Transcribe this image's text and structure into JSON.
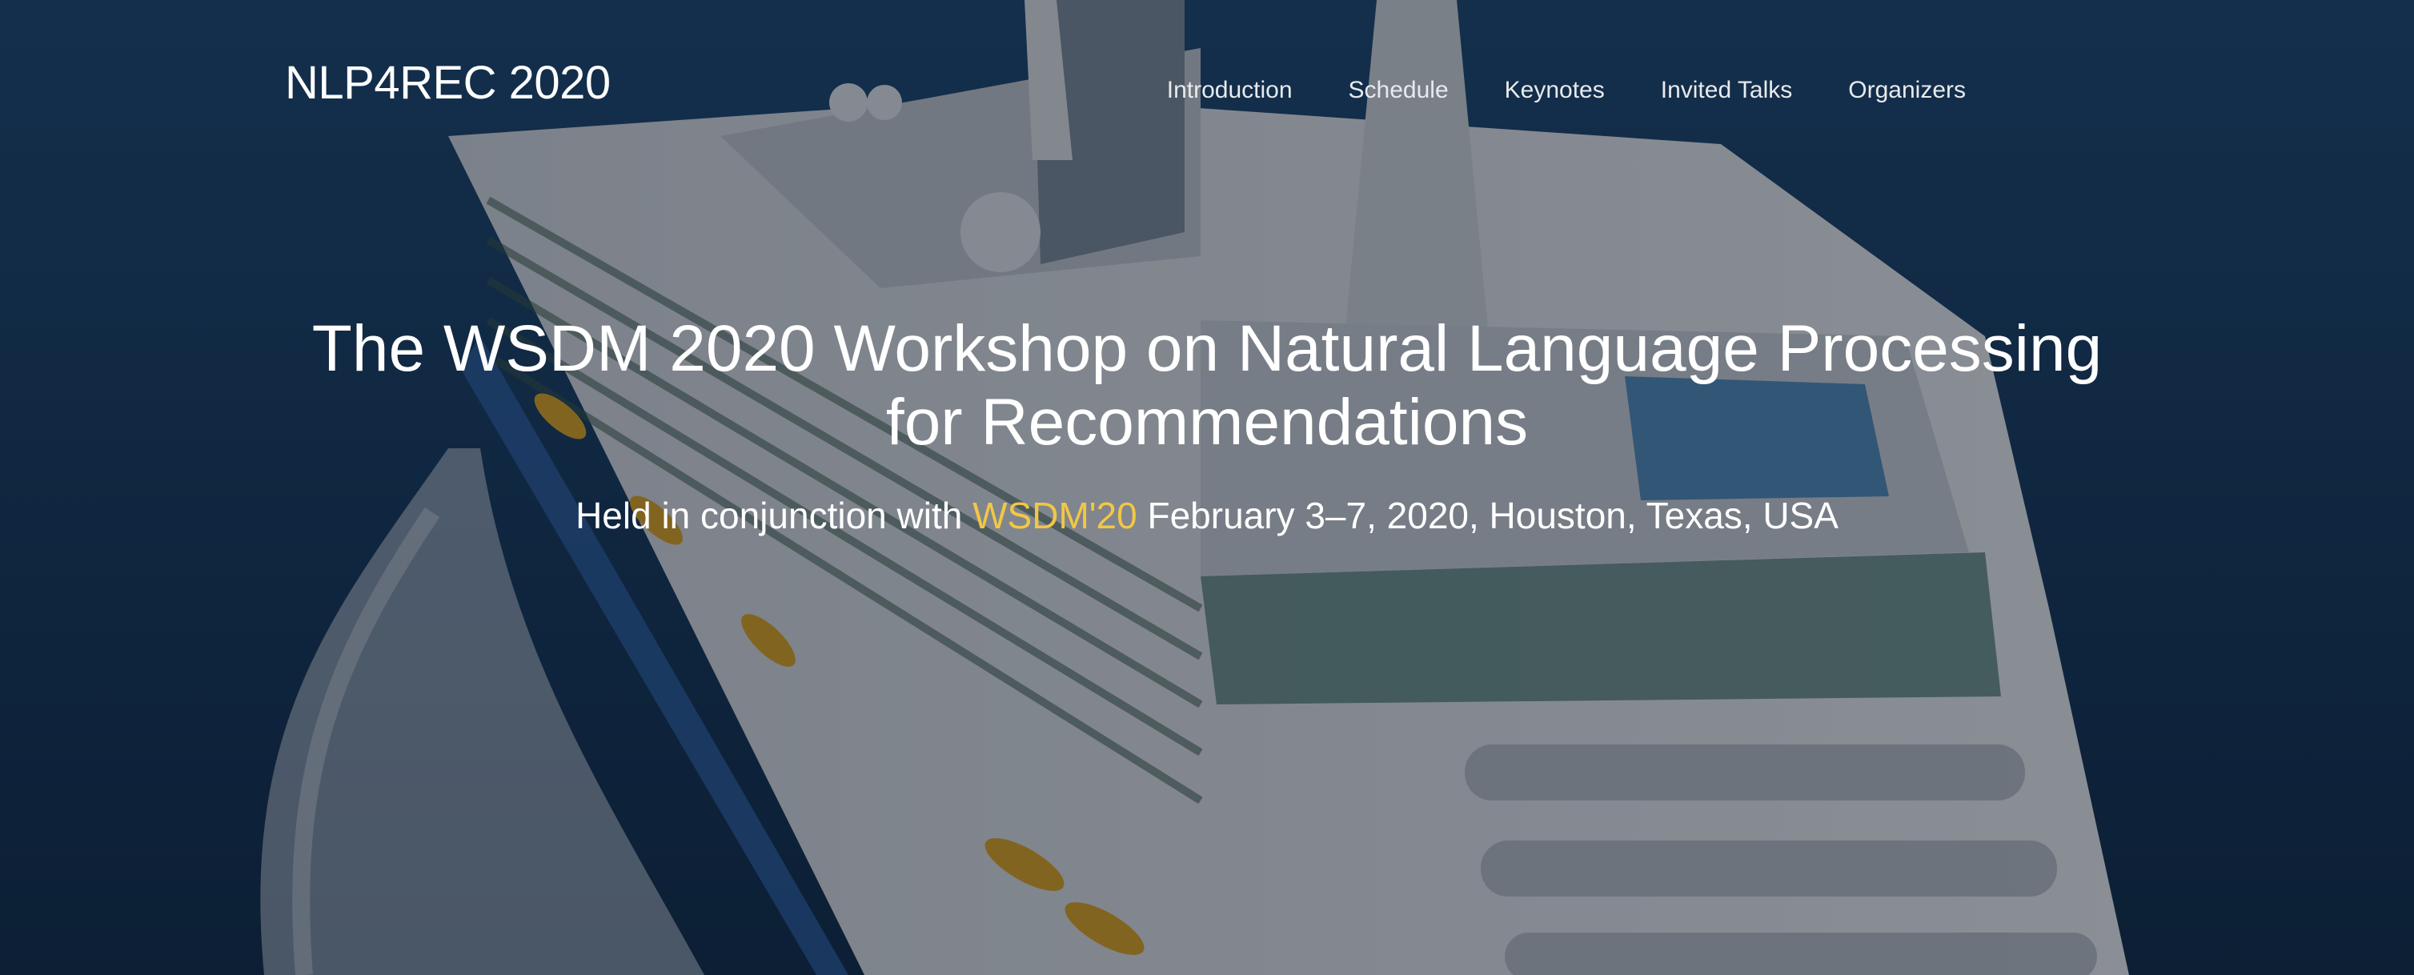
{
  "brand": "NLP4REC 2020",
  "nav": {
    "items": [
      {
        "label": "Introduction"
      },
      {
        "label": "Schedule"
      },
      {
        "label": "Keynotes"
      },
      {
        "label": "Invited Talks"
      },
      {
        "label": "Organizers"
      }
    ]
  },
  "hero": {
    "title": "The WSDM 2020 Workshop on Natural Language Processing for Recommendations",
    "subtitle_prefix": "Held in conjunction with",
    "subtitle_link": "WSDM'20",
    "subtitle_suffix": "February 3–7, 2020, Houston, Texas, USA"
  },
  "colors": {
    "accent": "#f2c744",
    "text": "#ffffff",
    "overlay": "#0a121e"
  }
}
